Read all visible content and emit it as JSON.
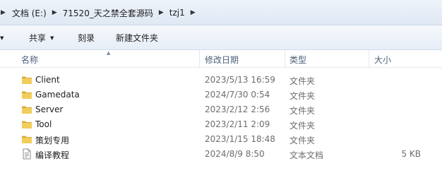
{
  "address": {
    "crumbs": [
      "文档 (E:)",
      "71520_天之禁全套源码",
      "tzj1"
    ]
  },
  "toolbar": {
    "share_label": "共享",
    "burn_label": "刻录",
    "new_folder_label": "新建文件夹"
  },
  "columns": {
    "name": "名称",
    "modified": "修改日期",
    "type": "类型",
    "size": "大小"
  },
  "files": [
    {
      "name": "Client",
      "modified": "2023/5/13 16:59",
      "type": "文件夹",
      "size": "",
      "icon": "folder-icon"
    },
    {
      "name": "Gamedata",
      "modified": "2024/7/30 0:54",
      "type": "文件夹",
      "size": "",
      "icon": "folder-icon"
    },
    {
      "name": "Server",
      "modified": "2023/2/12 2:56",
      "type": "文件夹",
      "size": "",
      "icon": "folder-icon"
    },
    {
      "name": "Tool",
      "modified": "2023/2/11 2:09",
      "type": "文件夹",
      "size": "",
      "icon": "folder-icon"
    },
    {
      "name": "策划专用",
      "modified": "2023/1/15 18:48",
      "type": "文件夹",
      "size": "",
      "icon": "folder-icon"
    },
    {
      "name": "编译教程",
      "modified": "2024/8/9 8:50",
      "type": "文本文档",
      "size": "5 KB",
      "icon": "text-file-icon"
    }
  ],
  "colors": {
    "folder": "#e8bd4f",
    "header_text": "#4c607a",
    "meta_text": "#6d6d6d"
  }
}
